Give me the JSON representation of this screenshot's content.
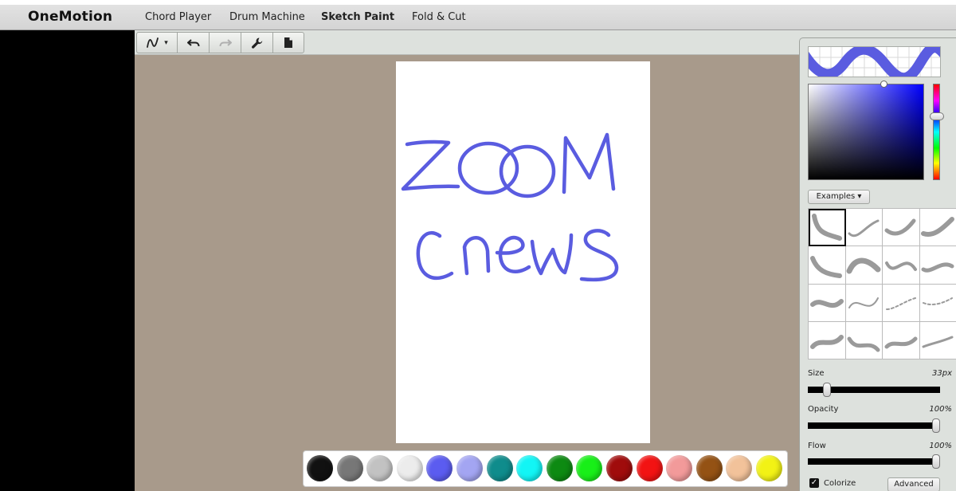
{
  "app": {
    "logo": "OneMotion"
  },
  "nav": {
    "items": [
      {
        "label": "Chord Player",
        "active": false
      },
      {
        "label": "Drum Machine",
        "active": false
      },
      {
        "label": "Sketch Paint",
        "active": true
      },
      {
        "label": "Fold & Cut",
        "active": false
      }
    ]
  },
  "toolbar": {
    "tools": [
      {
        "name": "brush-tool-dropdown",
        "icon": "brush-stroke-icon",
        "label": "▾"
      },
      {
        "name": "undo-button",
        "icon": "undo-icon"
      },
      {
        "name": "redo-button",
        "icon": "redo-icon",
        "disabled": true
      },
      {
        "name": "settings-button",
        "icon": "wrench-icon"
      },
      {
        "name": "new-document-button",
        "icon": "document-icon"
      }
    ]
  },
  "canvas": {
    "stroke_color": "#5a5ce0",
    "drawing_text_line1": "ZOOM",
    "drawing_text_line2": "cnews"
  },
  "palette": {
    "colors": [
      "#111111",
      "#777777",
      "#c2c2c2",
      "#ececec",
      "#5b5cf0",
      "#a3a5f2",
      "#0f8c8c",
      "#12f5f5",
      "#0d8a12",
      "#18ef18",
      "#a00c0c",
      "#f21313",
      "#f29a9a",
      "#945214",
      "#f2c29a",
      "#f2f215"
    ]
  },
  "panel": {
    "current_color": "#5a5ce0",
    "examples_label": "Examples ▾",
    "brushes_count": 16,
    "selected_brush": 0,
    "size": {
      "label": "Size",
      "value": "33px",
      "level": 0.12
    },
    "opacity": {
      "label": "Opacity",
      "value": "100%",
      "level": 1.0
    },
    "flow": {
      "label": "Flow",
      "value": "100%",
      "level": 1.0
    },
    "colorize": {
      "label": "Colorize",
      "checked": true
    },
    "advanced_label": "Advanced"
  }
}
